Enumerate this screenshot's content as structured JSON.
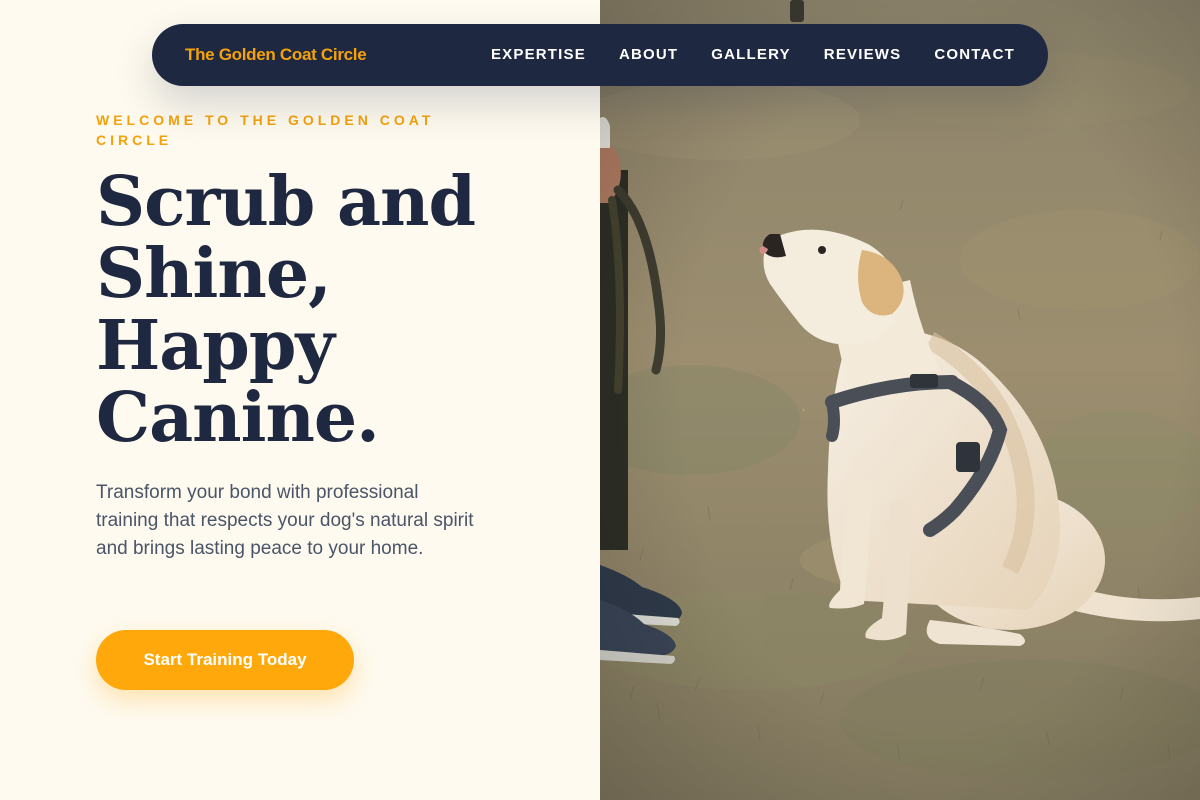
{
  "nav": {
    "brand": "The Golden Coat Circle",
    "links": [
      "EXPERTISE",
      "ABOUT",
      "GALLERY",
      "REVIEWS",
      "CONTACT"
    ]
  },
  "hero": {
    "eyebrow": "WELCOME TO THE GOLDEN COAT CIRCLE",
    "title": "Scrub and Shine, Happy Canine.",
    "subtitle": "Transform your bond with professional training that respects your dog's natural spirit and brings lasting peace to your home.",
    "cta_label": "Start Training Today"
  },
  "colors": {
    "accent": "#f5a20a",
    "button": "#ffa80b",
    "navy": "#1e2840",
    "background": "#fefaef",
    "body_text": "#4a5568"
  }
}
